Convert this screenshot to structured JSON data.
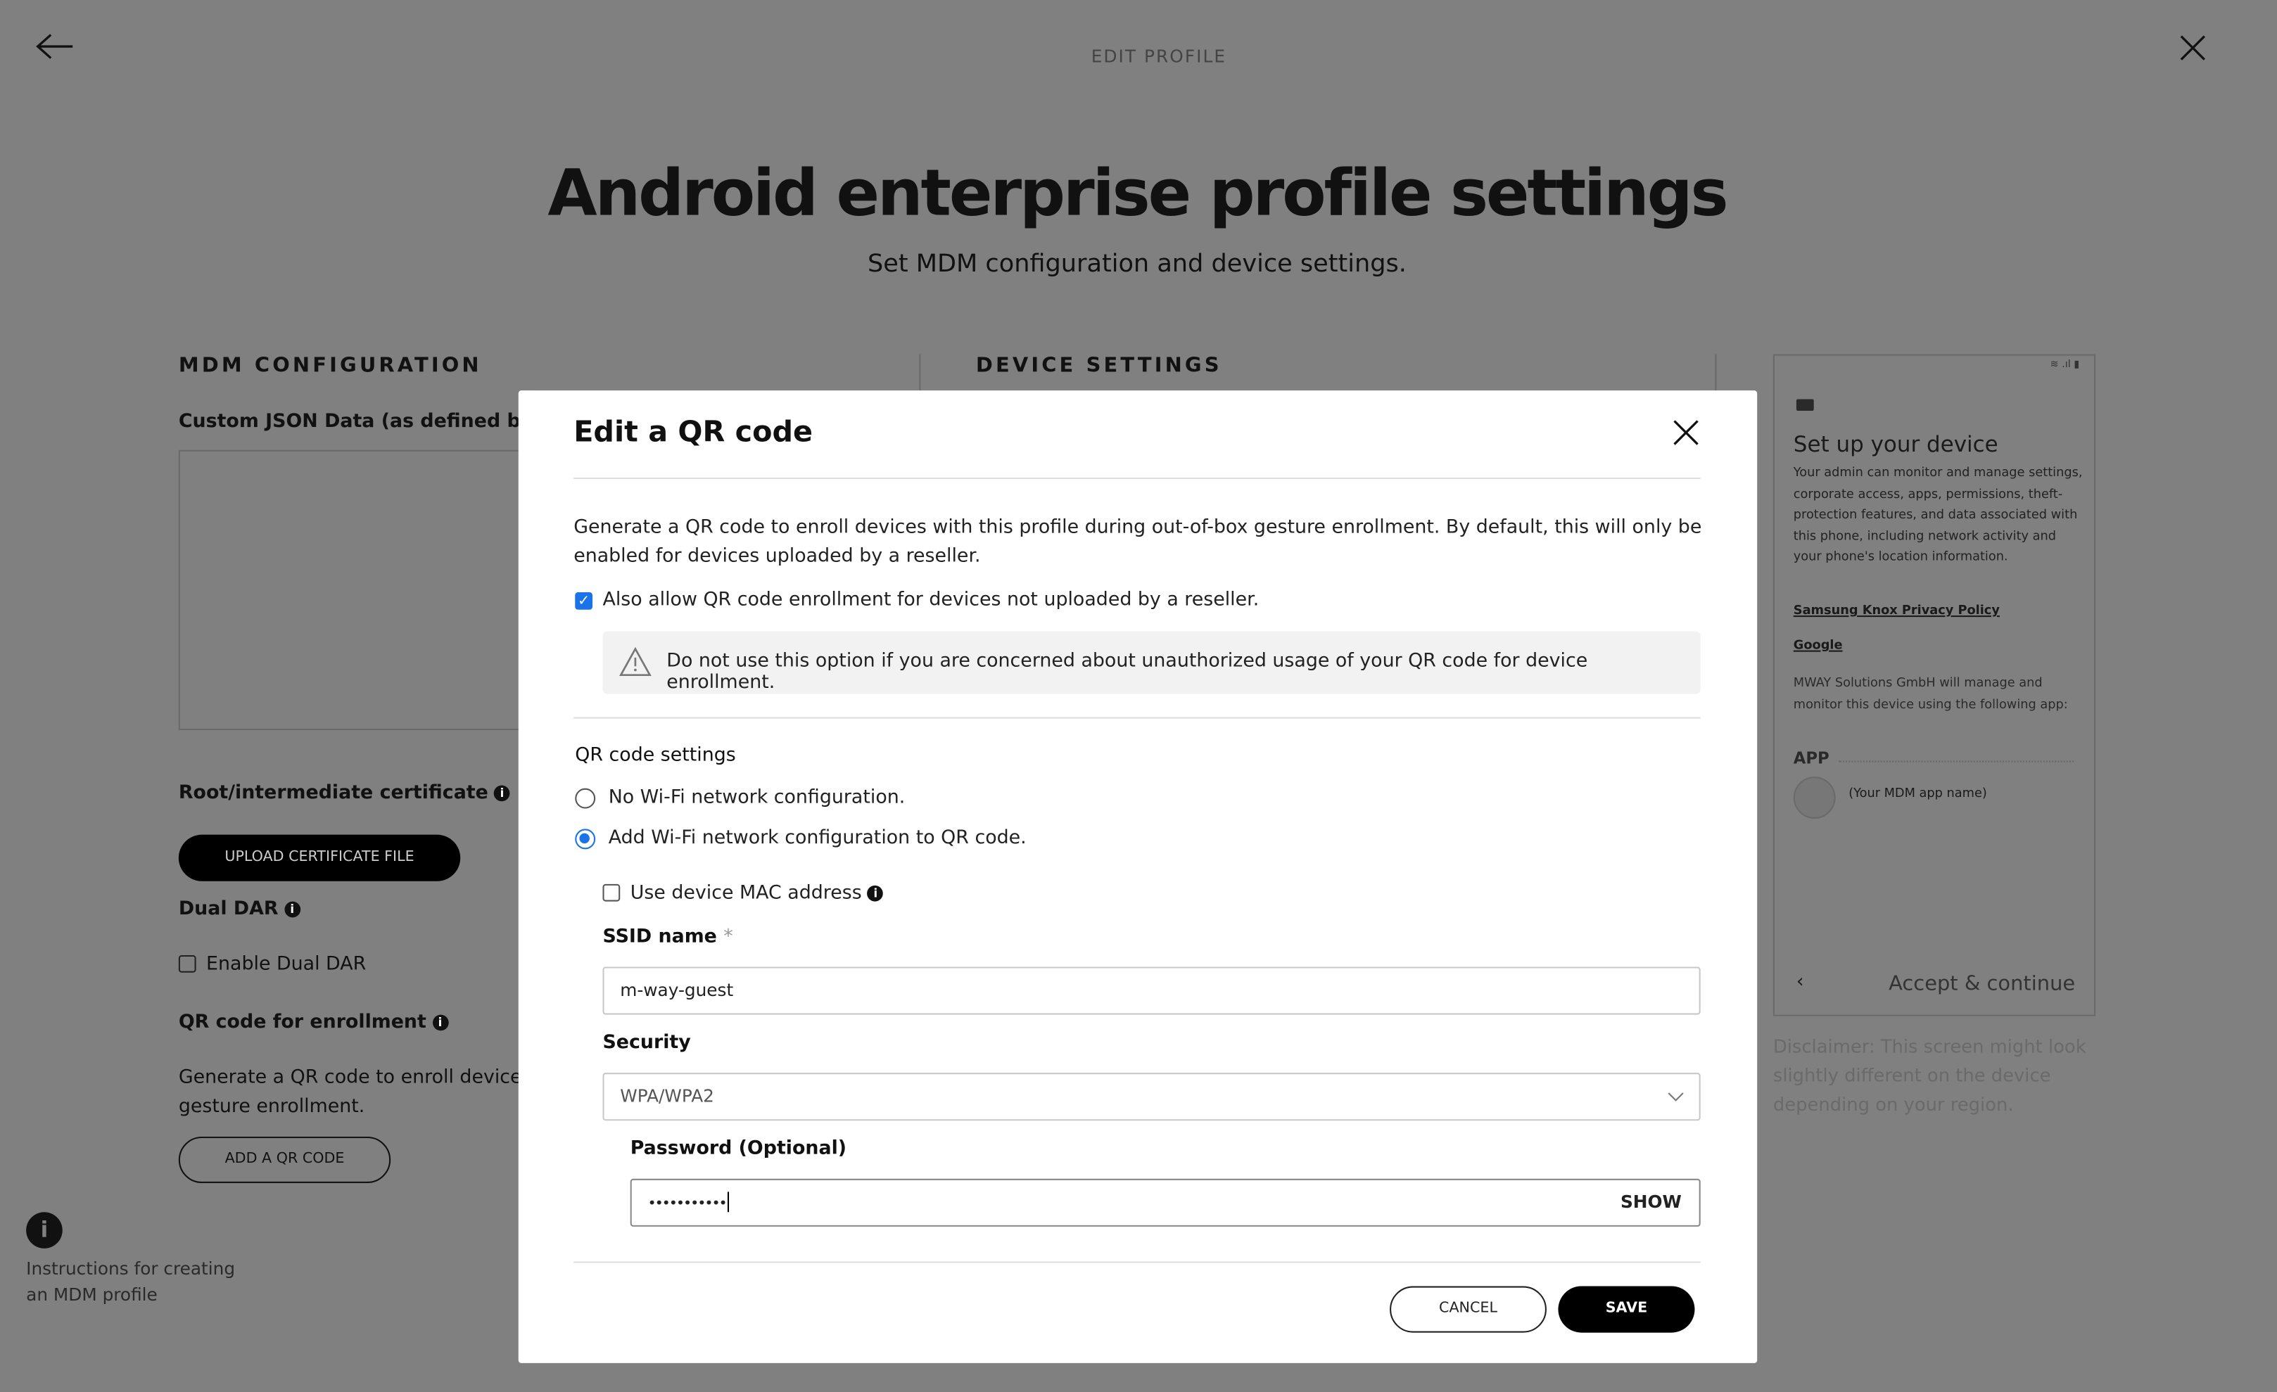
{
  "header": {
    "title": "EDIT PROFILE",
    "back_icon": "arrow-left-icon",
    "close_icon": "close-icon"
  },
  "page": {
    "title": "Android enterprise profile settings",
    "subtitle": "Set MDM configuration and device settings."
  },
  "mdm": {
    "section_title": "MDM CONFIGURATION",
    "custom_json_label": "Custom JSON Data (as defined by MDM",
    "root_cert_label": "Root/intermediate certificate",
    "upload_button": "UPLOAD CERTIFICATE FILE",
    "dual_dar_label": "Dual DAR",
    "enable_dual_dar": "Enable Dual DAR",
    "qr_label": "QR code for enrollment",
    "qr_desc_1": "Generate a QR code to enroll devices wi",
    "qr_desc_2": "gesture enrollment.",
    "add_qr_button": "ADD A QR CODE"
  },
  "device_settings": {
    "section_title": "DEVICE SETTINGS"
  },
  "instructions": {
    "line1": "Instructions for creating",
    "line2": "an MDM profile"
  },
  "phone_preview": {
    "title": "Set up your device",
    "body": "Your admin can monitor and manage settings, corporate access, apps, permissions, theft-protection features, and data associated with this phone, including network activity and your phone's location information.",
    "link1": "Samsung Knox Privacy Policy",
    "link2": "Google",
    "manage_text": "MWAY Solutions GmbH will manage and monitor this device using the following app:",
    "app_heading": "APP",
    "app_name": "(Your MDM app name)",
    "accept": "Accept & continue",
    "disclaimer": "Disclaimer: This screen might look slightly different on the device depending on your region."
  },
  "modal": {
    "title": "Edit a QR code",
    "description": "Generate a QR code to enroll devices with this profile during out-of-box gesture enrollment. By default, this will only be enabled for devices uploaded by a reseller.",
    "allow_unuploaded": {
      "label": "Also allow QR code enrollment for devices not uploaded by a reseller.",
      "checked": true
    },
    "warning": "Do not use this option if you are concerned about unauthorized usage of your QR code for device enrollment.",
    "qr_settings_label": "QR code settings",
    "radio_options": [
      {
        "label": "No Wi-Fi network configuration.",
        "selected": false
      },
      {
        "label": "Add Wi-Fi network configuration to QR code.",
        "selected": true
      }
    ],
    "mac_address": {
      "label": "Use device MAC address",
      "checked": false
    },
    "ssid": {
      "label": "SSID name",
      "required": "*",
      "value": "m-way-guest"
    },
    "security": {
      "label": "Security",
      "value": "WPA/WPA2"
    },
    "password": {
      "label": "Password (Optional)",
      "value": "•••••••••••",
      "show": "SHOW"
    },
    "cancel": "CANCEL",
    "save": "SAVE"
  },
  "colors": {
    "accent": "#1a73e8",
    "overlay": "#808080",
    "primary_button": "#000000"
  }
}
